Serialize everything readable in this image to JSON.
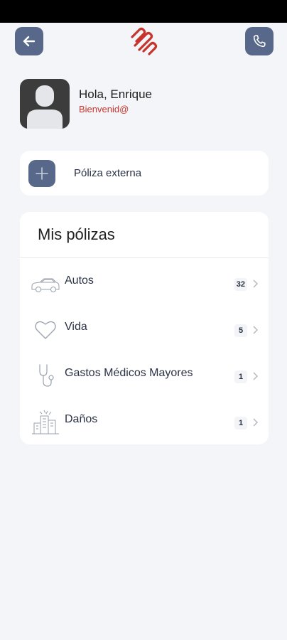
{
  "header": {
    "back_icon": "arrow-left-icon",
    "call_icon": "phone-icon",
    "logo": "brand-logo"
  },
  "user": {
    "greeting": "Hola, Enrique",
    "welcome": "Bienvenid@"
  },
  "external_policy": {
    "label": "Póliza externa",
    "icon": "plus-icon"
  },
  "policies": {
    "title": "Mis pólizas",
    "items": [
      {
        "label": "Autos",
        "count": "32",
        "icon": "car-icon"
      },
      {
        "label": "Vida",
        "count": "5",
        "icon": "heart-icon"
      },
      {
        "label": "Gastos Médicos Mayores",
        "count": "1",
        "icon": "stethoscope-icon"
      },
      {
        "label": "Daños",
        "count": "1",
        "icon": "buildings-icon"
      }
    ]
  },
  "colors": {
    "accent": "#57688a",
    "brand": "#c8332c",
    "background": "#f4f5f8"
  }
}
